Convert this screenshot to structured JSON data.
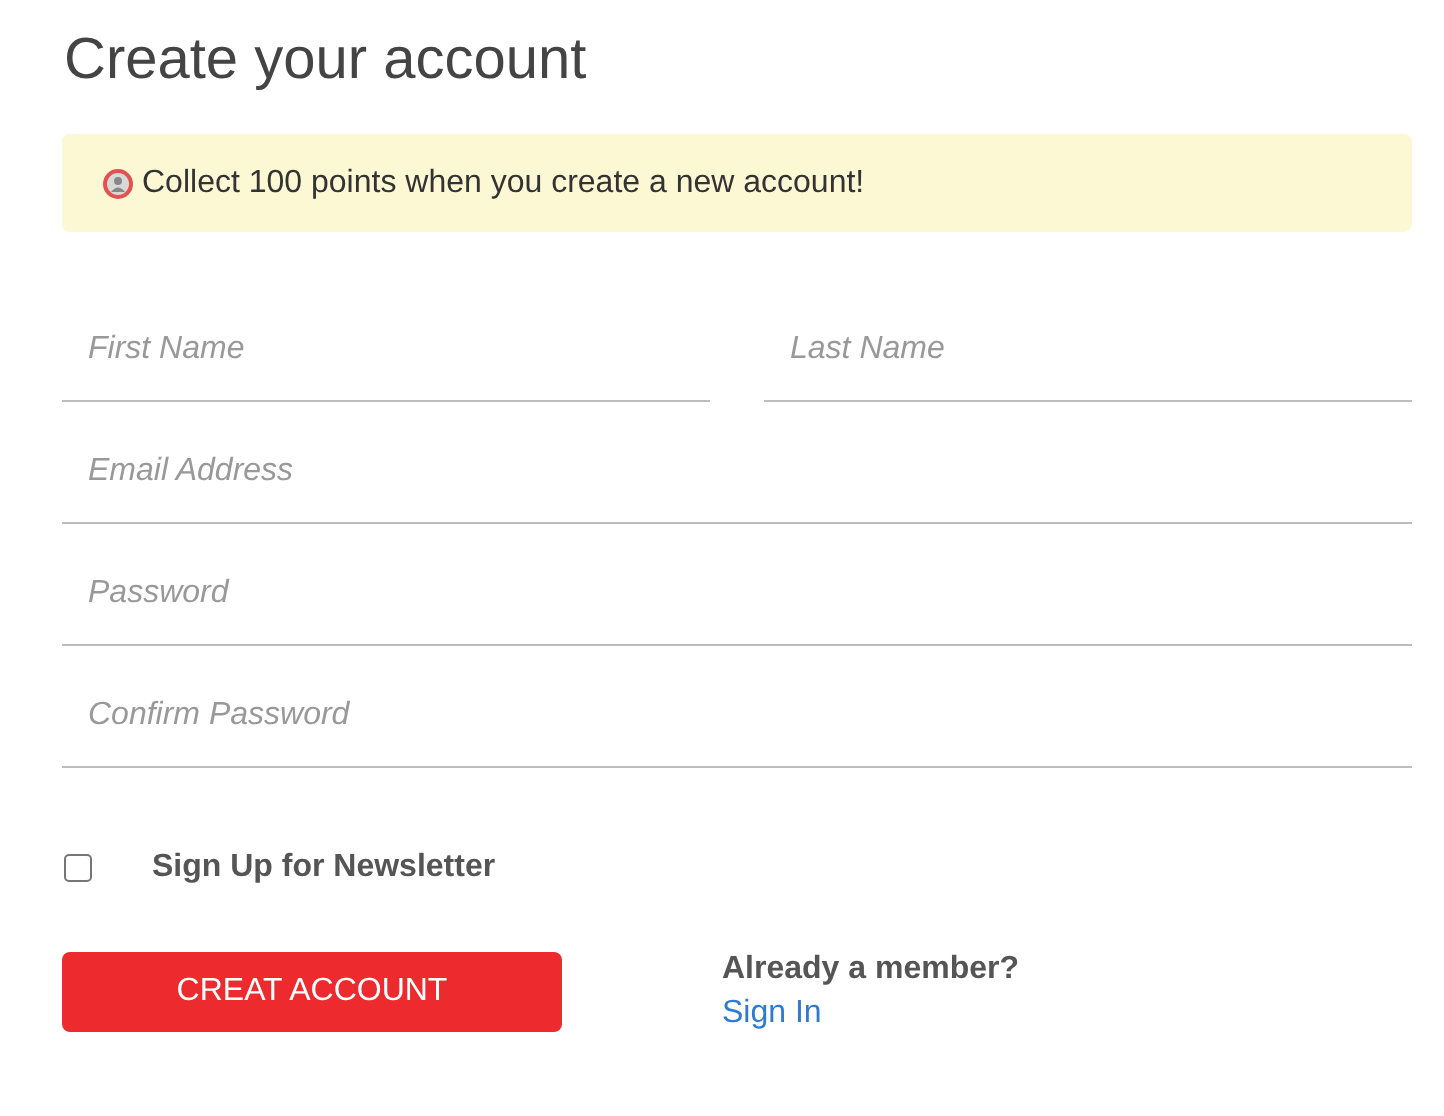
{
  "title": "Create your account",
  "banner": {
    "text": "Collect 100 points when you create a new account!"
  },
  "name_fields": [
    {
      "placeholder": "First Name"
    },
    {
      "placeholder": "Last Name"
    }
  ],
  "fields": [
    {
      "placeholder": "Email Address"
    },
    {
      "placeholder": "Password"
    },
    {
      "placeholder": "Confirm Password"
    }
  ],
  "newsletter": {
    "label": "Sign Up for Newsletter",
    "checked": false
  },
  "submit_button": "CREAT ACCOUNT",
  "member_prompt": "Already a member?",
  "sign_in_link": "Sign In"
}
